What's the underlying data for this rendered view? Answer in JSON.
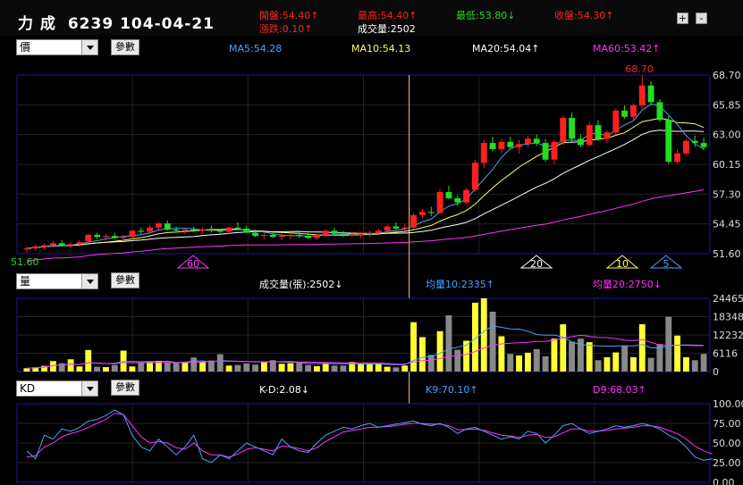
{
  "header": {
    "stock_name": "力  成",
    "stock_code_date": "6239 104-04-21",
    "open": "開盤:54.40↑",
    "high": "最高:54.40↑",
    "low": "最低:53.80↓",
    "close": "收盤:54.30↑",
    "change": "漲跌:0.10↑",
    "volume": "成交量:2502",
    "zoom_in": "+",
    "zoom_out": "-"
  },
  "price_panel": {
    "selector": "價",
    "param_button": "參數",
    "ma5": "MA5:54.28",
    "ma10": "MA10:54.13",
    "ma20": "MA20:54.04↑",
    "ma60": "MA60:53.42↑",
    "high_marker": "68.70",
    "low_marker": "51.60",
    "y_ticks": [
      "68.70",
      "65.85",
      "63.00",
      "60.15",
      "57.30",
      "54.45",
      "51.60"
    ],
    "ma_flags": [
      "60",
      "20",
      "10",
      "5"
    ]
  },
  "volume_panel": {
    "selector": "量",
    "param_button": "參數",
    "volume": "成交量(張):2502↓",
    "avg10": "均量10:2335↑",
    "avg20": "均量20:2750↓",
    "y_ticks": [
      "24465",
      "18348",
      "12232",
      "6116",
      "0"
    ]
  },
  "kd_panel": {
    "selector": "KD",
    "param_button": "參數",
    "kd": "K-D:2.08↓",
    "k9": "K9:70.10↑",
    "d9": "D9:68.03↑",
    "y_ticks": [
      "100.00",
      "75.00",
      "50.00",
      "25.00",
      "0.00"
    ]
  },
  "colors": {
    "up": "#ff2020",
    "down": "#22dd22",
    "ma5": "#4aa0ff",
    "ma10": "#ffff66",
    "ma20": "#ffffff",
    "ma60": "#ff33ff",
    "grid_border": "#1a1aa0",
    "cursor": "#ffcc66"
  },
  "chart_data": [
    {
      "type": "candlestick",
      "title": "力成 6239",
      "ylim": [
        51.6,
        68.7
      ],
      "ohlc": [
        [
          52.0,
          52.3,
          51.7,
          52.1
        ],
        [
          52.1,
          52.5,
          51.9,
          52.3
        ],
        [
          52.3,
          52.6,
          52.0,
          52.4
        ],
        [
          52.4,
          52.8,
          52.2,
          52.6
        ],
        [
          52.6,
          52.9,
          52.3,
          52.4
        ],
        [
          52.4,
          52.7,
          52.1,
          52.5
        ],
        [
          52.5,
          52.9,
          52.3,
          52.7
        ],
        [
          52.8,
          53.5,
          52.6,
          53.4
        ],
        [
          53.4,
          53.6,
          53.0,
          53.2
        ],
        [
          53.2,
          53.5,
          52.9,
          53.3
        ],
        [
          53.3,
          53.6,
          53.0,
          53.1
        ],
        [
          53.1,
          53.4,
          52.8,
          53.2
        ],
        [
          53.2,
          53.9,
          53.0,
          53.8
        ],
        [
          53.8,
          54.1,
          53.5,
          53.7
        ],
        [
          53.7,
          54.3,
          53.5,
          54.1
        ],
        [
          54.1,
          54.6,
          53.9,
          54.5
        ],
        [
          54.5,
          54.8,
          53.8,
          53.9
        ],
        [
          53.9,
          54.2,
          53.6,
          53.8
        ],
        [
          53.8,
          54.1,
          53.5,
          53.9
        ],
        [
          53.9,
          54.2,
          53.6,
          53.8
        ],
        [
          53.8,
          54.1,
          53.5,
          53.9
        ],
        [
          53.9,
          54.3,
          53.6,
          53.8
        ],
        [
          53.8,
          54.0,
          53.4,
          53.7
        ],
        [
          53.7,
          54.2,
          53.5,
          54.1
        ],
        [
          54.1,
          54.6,
          53.9,
          54.0
        ],
        [
          54.0,
          54.3,
          53.6,
          53.6
        ],
        [
          53.6,
          53.9,
          53.2,
          53.3
        ],
        [
          53.3,
          53.6,
          53.0,
          53.4
        ],
        [
          53.4,
          53.7,
          53.1,
          53.2
        ],
        [
          53.2,
          53.5,
          52.9,
          53.3
        ],
        [
          53.3,
          53.6,
          53.0,
          53.4
        ],
        [
          53.4,
          53.8,
          53.1,
          53.3
        ],
        [
          53.3,
          53.6,
          53.0,
          53.1
        ],
        [
          53.1,
          53.5,
          52.9,
          53.4
        ],
        [
          53.4,
          53.9,
          53.2,
          53.8
        ],
        [
          53.8,
          54.1,
          53.4,
          53.5
        ],
        [
          53.5,
          53.8,
          53.2,
          53.4
        ],
        [
          53.4,
          53.7,
          53.2,
          53.4
        ],
        [
          53.4,
          53.7,
          53.1,
          53.5
        ],
        [
          53.5,
          53.8,
          53.2,
          53.6
        ],
        [
          53.6,
          54.0,
          53.4,
          53.8
        ],
        [
          53.8,
          54.4,
          53.6,
          54.2
        ],
        [
          54.2,
          54.6,
          53.9,
          54.0
        ],
        [
          54.0,
          54.4,
          53.8,
          54.1
        ],
        [
          54.1,
          55.5,
          54.0,
          55.3
        ],
        [
          55.3,
          55.9,
          55.0,
          55.6
        ],
        [
          55.6,
          56.1,
          55.2,
          55.5
        ],
        [
          55.5,
          57.8,
          55.4,
          57.5
        ],
        [
          57.5,
          58.1,
          56.8,
          56.9
        ],
        [
          56.9,
          57.2,
          56.2,
          56.5
        ],
        [
          56.5,
          57.9,
          56.3,
          57.7
        ],
        [
          57.7,
          60.6,
          57.5,
          60.3
        ],
        [
          60.3,
          62.5,
          59.8,
          62.2
        ],
        [
          62.2,
          62.8,
          61.4,
          61.6
        ],
        [
          61.6,
          62.6,
          61.2,
          62.3
        ],
        [
          62.3,
          62.8,
          61.6,
          61.8
        ],
        [
          61.8,
          62.5,
          61.2,
          62.1
        ],
        [
          62.1,
          62.9,
          61.8,
          62.6
        ],
        [
          62.6,
          63.0,
          61.9,
          62.2
        ],
        [
          62.2,
          62.6,
          60.4,
          60.6
        ],
        [
          60.6,
          62.5,
          60.2,
          62.3
        ],
        [
          62.3,
          64.8,
          62.0,
          64.6
        ],
        [
          64.6,
          65.1,
          62.3,
          62.6
        ],
        [
          62.6,
          63.0,
          61.8,
          62.0
        ],
        [
          62.0,
          64.2,
          61.9,
          63.9
        ],
        [
          63.9,
          64.4,
          62.4,
          62.6
        ],
        [
          62.6,
          63.4,
          62.2,
          63.2
        ],
        [
          63.2,
          65.5,
          63.0,
          65.3
        ],
        [
          65.3,
          65.8,
          64.5,
          64.7
        ],
        [
          64.7,
          66.0,
          64.3,
          65.8
        ],
        [
          65.8,
          68.7,
          65.5,
          67.7
        ],
        [
          67.7,
          68.1,
          65.8,
          66.1
        ],
        [
          66.1,
          66.4,
          64.2,
          64.4
        ],
        [
          64.4,
          64.8,
          60.2,
          60.4
        ],
        [
          60.4,
          61.6,
          60.2,
          61.2
        ],
        [
          61.2,
          62.6,
          61.0,
          62.4
        ],
        [
          62.4,
          62.9,
          61.8,
          62.2
        ],
        [
          62.2,
          62.7,
          61.5,
          61.8
        ]
      ]
    },
    {
      "type": "bar",
      "title": "成交量",
      "ylim": [
        0,
        24465
      ],
      "values": [
        1100,
        1400,
        1900,
        3500,
        2800,
        4100,
        1700,
        7200,
        1600,
        1500,
        2200,
        7000,
        1700,
        3100,
        3400,
        3600,
        3200,
        2900,
        3000,
        4700,
        3200,
        3700,
        5800,
        2000,
        2200,
        2700,
        2300,
        3300,
        3800,
        2600,
        2800,
        3100,
        2200,
        1800,
        2500,
        2000,
        2000,
        3200,
        2700,
        3000,
        2800,
        1600,
        1400,
        2000,
        16500,
        11500,
        5600,
        13500,
        18800,
        7300,
        10300,
        23000,
        26000,
        20000,
        11800,
        5900,
        5400,
        6300,
        7500,
        5100,
        11000,
        15800,
        10000,
        11000,
        9800,
        3800,
        4800,
        6400,
        8500,
        4800,
        15800,
        4600,
        9200,
        18300,
        12000,
        4800,
        3800,
        5900
      ]
    },
    {
      "type": "line",
      "title": "KD",
      "ylim": [
        0,
        100
      ],
      "series": [
        {
          "name": "K9",
          "values": [
            40,
            30,
            60,
            55,
            68,
            65,
            70,
            78,
            80,
            85,
            92,
            86,
            60,
            45,
            40,
            55,
            45,
            35,
            45,
            60,
            30,
            25,
            35,
            30,
            40,
            50,
            45,
            40,
            35,
            55,
            45,
            40,
            38,
            50,
            60,
            65,
            70,
            68,
            72,
            75,
            70,
            72,
            74,
            76,
            78,
            74,
            72,
            75,
            70,
            62,
            68,
            70,
            65,
            60,
            55,
            58,
            55,
            65,
            62,
            50,
            60,
            72,
            75,
            68,
            62,
            65,
            68,
            72,
            70,
            72,
            75,
            72,
            68,
            60,
            55,
            45,
            32,
            28,
            30
          ]
        },
        {
          "name": "D9",
          "values": [
            32,
            34,
            45,
            50,
            58,
            62,
            65,
            70,
            75,
            80,
            88,
            86,
            72,
            58,
            50,
            52,
            50,
            44,
            42,
            50,
            40,
            35,
            35,
            32,
            36,
            42,
            44,
            42,
            40,
            46,
            45,
            43,
            40,
            44,
            52,
            58,
            64,
            66,
            68,
            70,
            70,
            71,
            72,
            74,
            75,
            75,
            74,
            74,
            72,
            67,
            67,
            68,
            66,
            63,
            60,
            59,
            57,
            60,
            61,
            57,
            58,
            63,
            68,
            68,
            65,
            65,
            66,
            68,
            69,
            70,
            72,
            72,
            70,
            66,
            62,
            55,
            46,
            40,
            36
          ]
        }
      ]
    }
  ]
}
